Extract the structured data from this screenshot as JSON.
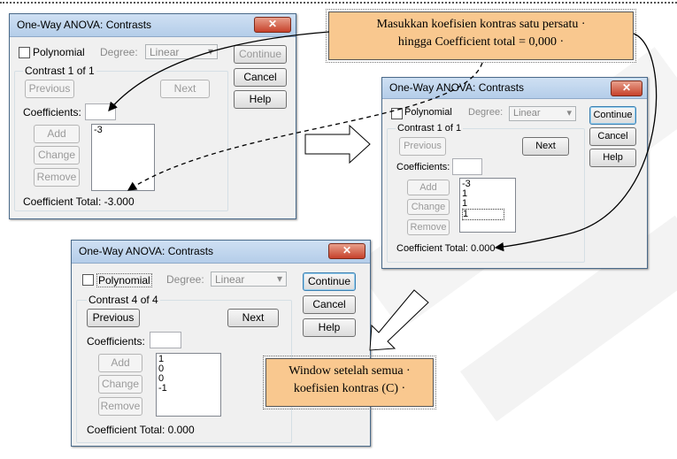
{
  "d1": {
    "title": "One-Way ANOVA: Contrasts",
    "close": "✕",
    "polynomial": "Polynomial",
    "degree_label": "Degree:",
    "degree_value": "Linear",
    "contrast_label": "Contrast 1 of 1",
    "previous": "Previous",
    "next": "Next",
    "coefficients_label": "Coefficients:",
    "coefficient_input": "",
    "add": "Add",
    "change": "Change",
    "remove": "Remove",
    "list": [
      "-3"
    ],
    "total": "Coefficient Total: -3.000",
    "continue": "Continue",
    "cancel": "Cancel",
    "help": "Help"
  },
  "d2": {
    "title": "One-Way ANOVA: Contrasts",
    "close": "✕",
    "polynomial": "Polynomial",
    "degree_label": "Degree:",
    "degree_value": "Linear",
    "contrast_label": "Contrast 1 of 1",
    "previous": "Previous",
    "next": "Next",
    "coefficients_label": "Coefficients:",
    "coefficient_input": "",
    "add": "Add",
    "change": "Change",
    "remove": "Remove",
    "list": [
      "-3",
      "1",
      "1",
      "1"
    ],
    "total": "Coefficient Total: 0.000",
    "continue": "Continue",
    "cancel": "Cancel",
    "help": "Help"
  },
  "d3": {
    "title": "One-Way ANOVA: Contrasts",
    "close": "✕",
    "polynomial": "Polynomial",
    "degree_label": "Degree:",
    "degree_value": "Linear",
    "contrast_label": "Contrast 4 of 4",
    "previous": "Previous",
    "next": "Next",
    "coefficients_label": "Coefficients:",
    "coefficient_input": "",
    "add": "Add",
    "change": "Change",
    "remove": "Remove",
    "list": [
      "1",
      "0",
      "0",
      "-1"
    ],
    "total": "Coefficient Total: 0.000",
    "continue": "Continue",
    "cancel": "Cancel",
    "help": "Help"
  },
  "notes": {
    "top_line1": "Masukkan koefisien kontras satu persatu ·",
    "top_line2": "hingga Coefficient total = 0,000 ·",
    "bottom_line1": "Window setelah semua ·",
    "bottom_line2": "koefisien kontras (C) ·"
  },
  "colors": {
    "note_fill": "#f9c88f",
    "titlebar": "#c4d8ef",
    "close_button": "#c7412b"
  }
}
